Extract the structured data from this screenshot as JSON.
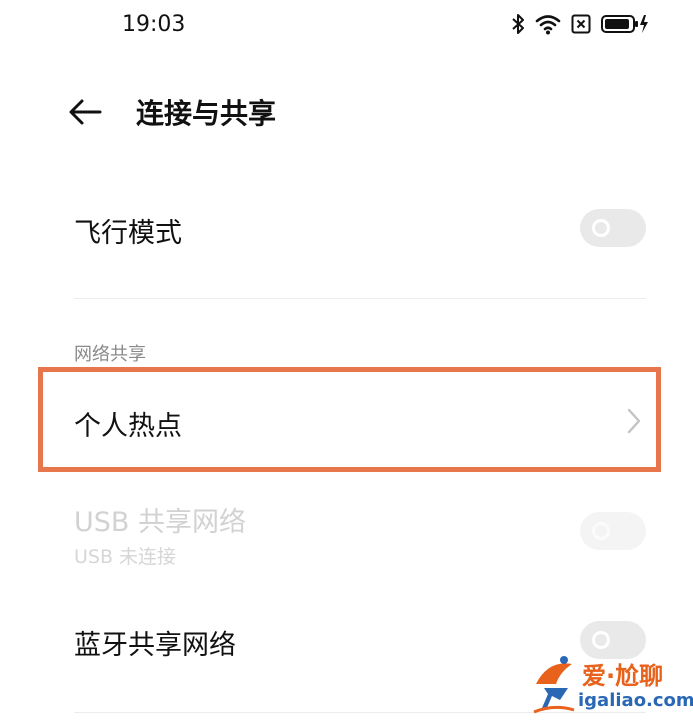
{
  "status_bar": {
    "time": "19:03",
    "icons": [
      "bluetooth-icon",
      "wifi-icon",
      "sim-off-icon",
      "battery-charging-icon"
    ]
  },
  "header": {
    "back_icon": "arrow-left-icon",
    "title": "连接与共享"
  },
  "airplane_mode": {
    "label": "飞行模式",
    "enabled": false
  },
  "network_sharing": {
    "section_title": "网络共享",
    "hotspot": {
      "label": "个人热点",
      "icon": "chevron-right-icon",
      "highlighted": true,
      "highlight_color": "#e8764c"
    },
    "usb": {
      "label": "USB 共享网络",
      "sublabel": "USB 未连接",
      "enabled": false,
      "available": false
    },
    "bluetooth": {
      "label": "蓝牙共享网络",
      "enabled": false
    }
  },
  "watermark": {
    "brand": "爱·尬聊",
    "url": "igaliao.com",
    "colors": {
      "brand": "#e8621c",
      "url": "#2a68b5"
    }
  }
}
